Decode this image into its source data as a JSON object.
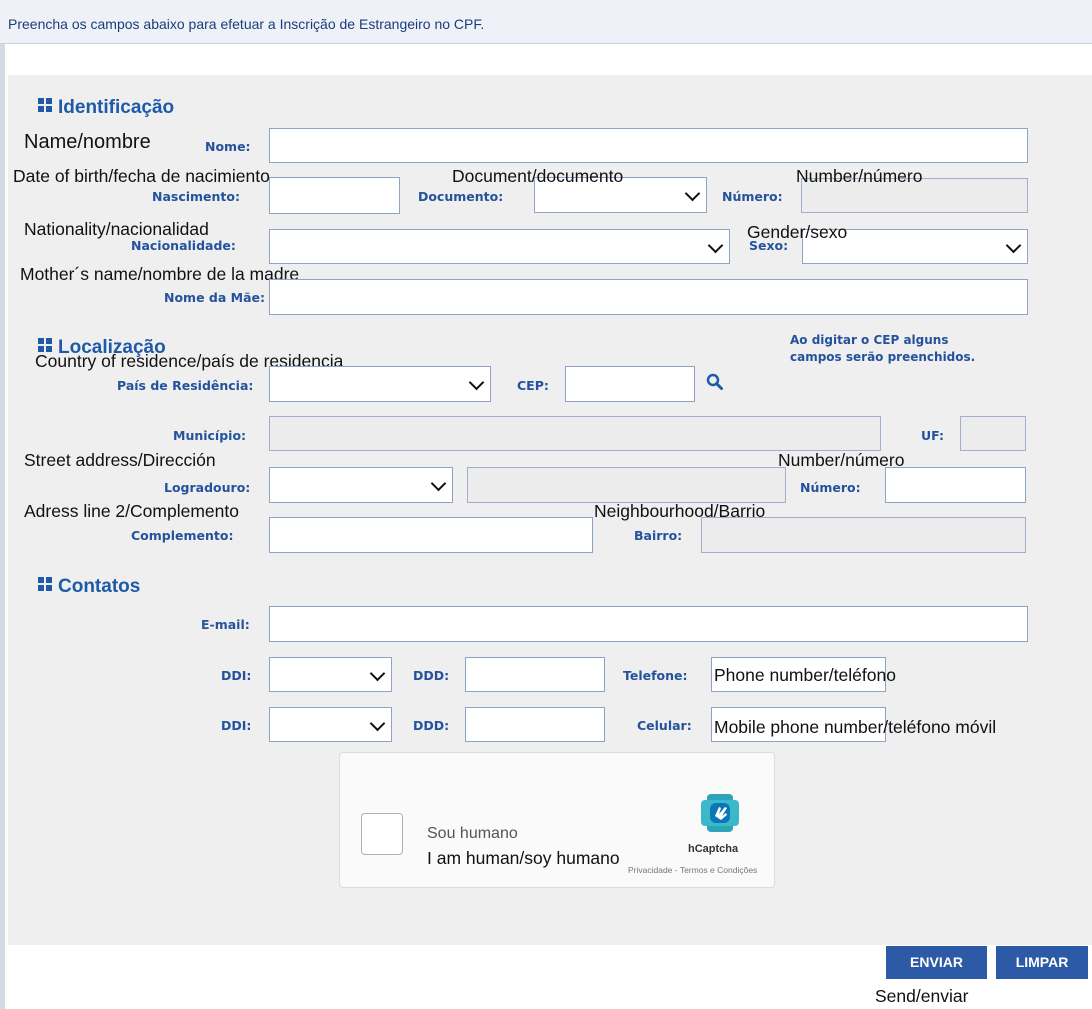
{
  "banner": {
    "text": "Preencha os campos abaixo para efetuar a Inscrição de Estrangeiro no CPF."
  },
  "sections": {
    "identificacao": "Identificação",
    "localizacao": "Localização",
    "contatos": "Contatos"
  },
  "labels": {
    "nome": "Nome:",
    "nascimento": "Nascimento:",
    "documento": "Documento:",
    "numero_doc": "Número:",
    "nacionalidade": "Nacionalidade:",
    "sexo": "Sexo:",
    "nome_mae": "Nome da Mãe:",
    "pais": "País de Residência:",
    "cep": "CEP:",
    "municipio": "Município:",
    "uf": "UF:",
    "logradouro": "Logradouro:",
    "numero_end": "Número:",
    "complemento": "Complemento:",
    "bairro": "Bairro:",
    "email": "E-mail:",
    "ddi1": "DDI:",
    "ddd1": "DDD:",
    "telefone": "Telefone:",
    "ddi2": "DDI:",
    "ddd2": "DDD:",
    "celular": "Celular:"
  },
  "annotations": {
    "name": "Name/nombre",
    "dob": "Date of birth/fecha de nacimiento",
    "document": "Document/documento",
    "number_doc": "Number/número",
    "nationality": "Nationality/nacionalidad",
    "gender": "Gender/sexo",
    "mother": "Mother´s name/nombre de la madre",
    "country": "Country of residence/país de residencia",
    "street": "Street address/Dirección",
    "number_addr": "Number/número",
    "address2": "Adress line 2/Complemento",
    "neighbourhood": "Neighbourhood/Barrio",
    "phone": "Phone number/teléfono",
    "mobile": "Mobile phone number/teléfono móvil",
    "human": "I am human/soy humano",
    "send": "Send/enviar"
  },
  "cep_hint": {
    "line1": "Ao digitar o CEP alguns",
    "line2": "campos serão preenchidos."
  },
  "captcha": {
    "label": "Sou humano",
    "brand": "hCaptcha",
    "footer": "Privacidade - Termos e Condições"
  },
  "buttons": {
    "send": "ENVIAR",
    "clear": "LIMPAR"
  },
  "icons": {
    "cep_search": "search-icon",
    "captcha_logo": "hcaptcha-logo-icon",
    "section": "grid-icon"
  },
  "colors": {
    "accent": "#1f5aa8",
    "button": "#2d5aa6",
    "label": "#24529c"
  }
}
